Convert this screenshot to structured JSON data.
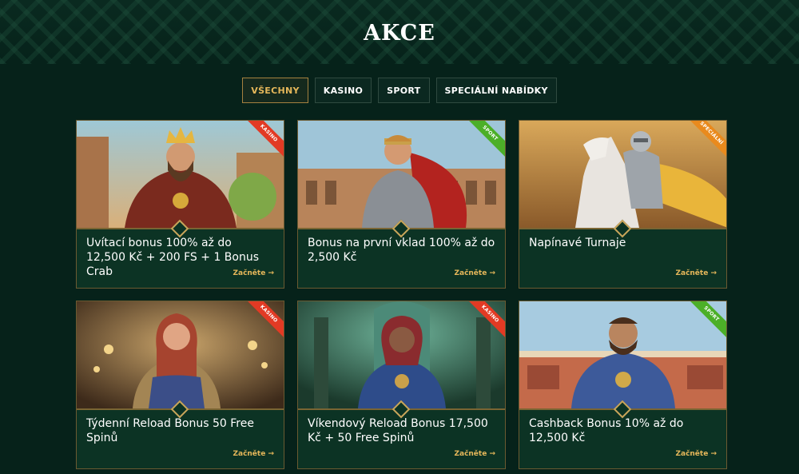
{
  "page": {
    "title": "AKCE"
  },
  "tabs": [
    {
      "label": "VŠECHNY",
      "active": true
    },
    {
      "label": "KASINO"
    },
    {
      "label": "SPORT"
    },
    {
      "label": "SPECIÁLNÍ NABÍDKY"
    }
  ],
  "colors": {
    "accent": "#e5b75a",
    "kasino": "#e23a24",
    "sport": "#4caf28",
    "special": "#e98a1d",
    "background": "#06221a"
  },
  "cards": [
    {
      "title": "Uvítací bonus 100% až do 12,500 Kč + 200 FS + 1 Bonus Crab",
      "link": "Začněte →",
      "badge": "KASINO",
      "image": "king-icon"
    },
    {
      "title": "Bonus na první vklad 100% až do 2,500 Kč",
      "link": "Začněte →",
      "badge": "SPORT",
      "image": "gladiator-icon"
    },
    {
      "title": "Napínavé Turnaje",
      "link": "Začněte →",
      "badge": "SPECIÁLNÍ",
      "image": "knight-horse-icon"
    },
    {
      "title": "Týdenní Reload Bonus 50 Free Spinů",
      "link": "Začněte →",
      "badge": "KASINO",
      "image": "female-warrior-icon"
    },
    {
      "title": "Víkendový Reload Bonus 17,500 Kč + 50 Free Spinů",
      "link": "Začněte →",
      "badge": "KASINO",
      "image": "armored-lady-icon"
    },
    {
      "title": "Cashback Bonus 10% až do 12,500 Kč",
      "link": "Začněte →",
      "badge": "SPORT",
      "image": "knight-arena-icon"
    }
  ]
}
